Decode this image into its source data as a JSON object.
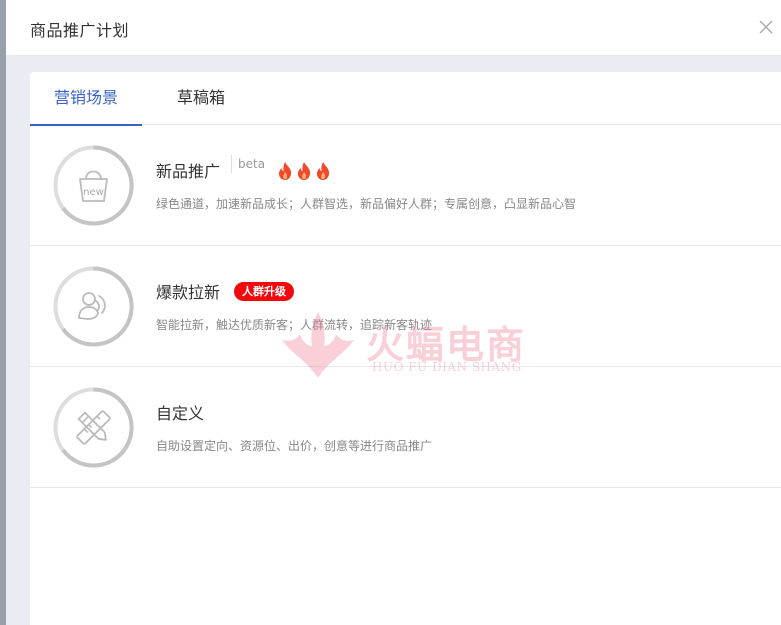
{
  "dialog": {
    "title": "商品推广计划",
    "close_icon": "close-icon"
  },
  "tabs": [
    {
      "label": "营销场景",
      "active": true
    },
    {
      "label": "草稿箱",
      "active": false
    }
  ],
  "scenes": [
    {
      "title": "新品推广",
      "tag": "beta",
      "hot_count": 3,
      "icon": "new-bag-icon",
      "icon_label": "new",
      "description": "绿色通道，加速新品成长；人群智选，新品偏好人群；专属创意，凸显新品心智"
    },
    {
      "title": "爆款拉新",
      "badge": "人群升级",
      "icon": "new-customer-icon",
      "description": "智能拉新，触达优质新客；人群流转，追踪新客轨迹"
    },
    {
      "title": "自定义",
      "icon": "pencil-ruler-icon",
      "description": "自助设置定向、资源位、出价，创意等进行商品推广"
    }
  ],
  "watermark": {
    "cn": "火蝠电商",
    "en": "HUO FU DIAN SHANG"
  },
  "colors": {
    "accent": "#3a63c8",
    "badge": "#f1090e",
    "fire": "#f04a2a"
  }
}
